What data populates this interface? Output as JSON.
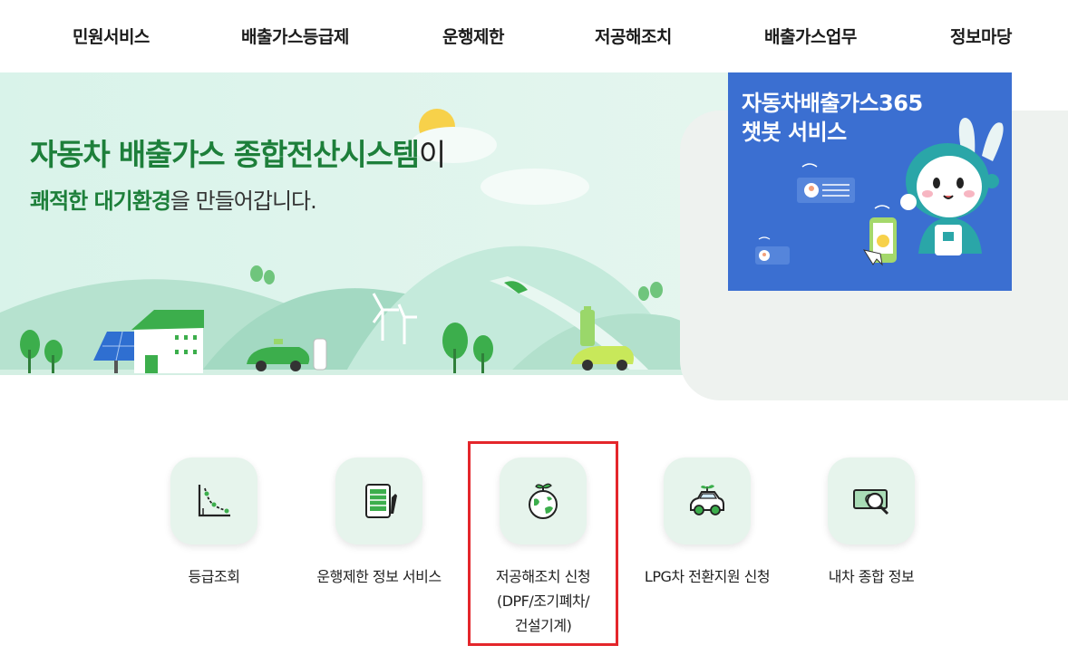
{
  "nav": {
    "items": [
      "민원서비스",
      "배출가스등급제",
      "운행제한",
      "저공해조치",
      "배출가스업무",
      "정보마당"
    ]
  },
  "hero": {
    "title_accent": "자동차 배출가스 종합전산시스템",
    "title_tail": "이",
    "sub_accent": "쾌적한 대기환경",
    "sub_tail": "을 만들어갑니다."
  },
  "chatbot": {
    "line1": "자동차배출가스365",
    "line2": "챗봇 서비스"
  },
  "quick_menu": [
    {
      "label": "등급조회",
      "icon": "chart-curve-icon"
    },
    {
      "label": "운행제한 정보 서비스",
      "icon": "battery-document-icon"
    },
    {
      "label": "저공해조치 신청\n(DPF/조기폐차/\n건설기계)",
      "icon": "earth-sprout-icon"
    },
    {
      "label": "LPG차 전환지원 신청",
      "icon": "eco-car-icon"
    },
    {
      "label": "내차 종합 정보",
      "icon": "money-search-icon"
    }
  ],
  "colors": {
    "brand_green": "#1d7f3a",
    "icon_box": "#e6f4ec",
    "chatbot_blue": "#3b6fd1",
    "highlight_red": "#e4262b"
  }
}
